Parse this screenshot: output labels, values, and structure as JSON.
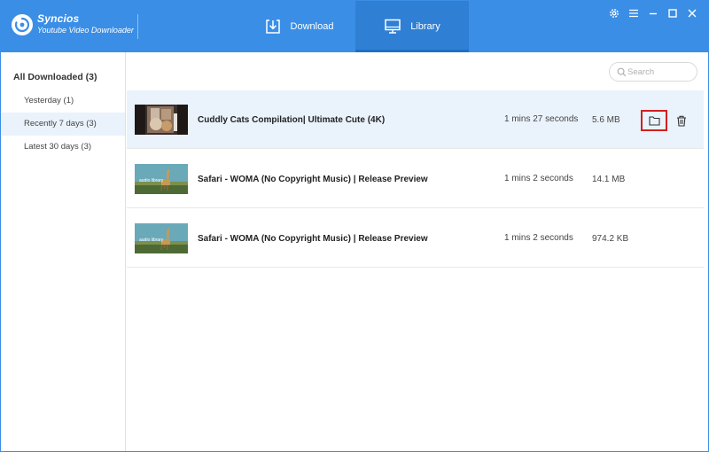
{
  "app": {
    "name": "Syncios",
    "subtitle": "Youtube Video Downloader"
  },
  "nav": {
    "download_label": "Download",
    "library_label": "Library",
    "active": "Library"
  },
  "window_controls": [
    "gear-icon",
    "menu-icon",
    "minimize-icon",
    "maximize-icon",
    "close-icon"
  ],
  "sidebar": {
    "header": "All Downloaded (3)",
    "items": [
      {
        "label": "Yesterday (1)"
      },
      {
        "label": "Recently 7 days (3)",
        "active": true
      },
      {
        "label": "Latest 30 days (3)"
      }
    ]
  },
  "search": {
    "placeholder": "Search",
    "value": ""
  },
  "videos": [
    {
      "title": "Cuddly Cats Compilation| Ultimate Cute (4K)",
      "duration": "1 mins 27 seconds",
      "size": "5.6 MB",
      "selected": true
    },
    {
      "title": "Safari - WOMA (No Copyright Music) | Release Preview",
      "duration": "1 mins 2 seconds",
      "size": "14.1 MB"
    },
    {
      "title": "Safari - WOMA (No Copyright Music) | Release Preview",
      "duration": "1 mins 2 seconds",
      "size": "974.2 KB"
    }
  ],
  "thumb_text": "audio library",
  "colors": {
    "accent": "#3a8ee6",
    "accent_dark": "#2f7fd4",
    "row_highlight": "#eaf3fc",
    "focus_box": "#d21f1f"
  }
}
